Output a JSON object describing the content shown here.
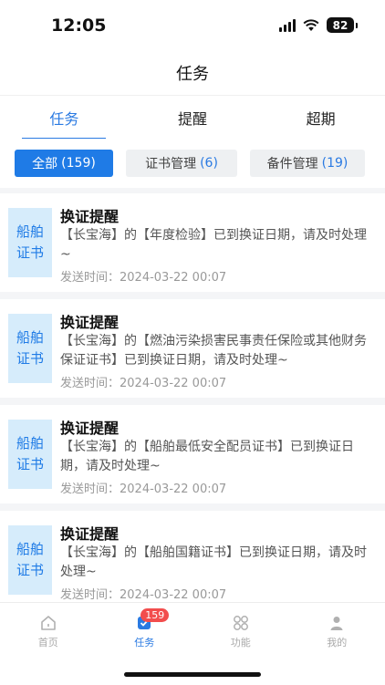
{
  "status_bar": {
    "time": "12:05",
    "battery": "82"
  },
  "nav": {
    "title": "任务"
  },
  "tabs": [
    {
      "label": "任务",
      "active": true
    },
    {
      "label": "提醒",
      "active": false
    },
    {
      "label": "超期",
      "active": false
    }
  ],
  "filters": [
    {
      "label": "全部",
      "count": "(159)",
      "active": true
    },
    {
      "label": "证书管理",
      "count": "(6)",
      "active": false
    },
    {
      "label": "备件管理",
      "count": "(19)",
      "active": false
    }
  ],
  "cards": [
    {
      "badge": "船舶证书",
      "title": "换证提醒",
      "body": "【长宝海】的【年度检验】已到换证日期，请及时处理~",
      "time": "发送时间：2024-03-22 00:07"
    },
    {
      "badge": "船舶证书",
      "title": "换证提醒",
      "body": "【长宝海】的【燃油污染损害民事责任保险或其他财务保证证书】已到换证日期，请及时处理~",
      "time": "发送时间：2024-03-22 00:07"
    },
    {
      "badge": "船舶证书",
      "title": "换证提醒",
      "body": "【长宝海】的【船舶最低安全配员证书】已到换证日期，请及时处理~",
      "time": "发送时间：2024-03-22 00:07"
    },
    {
      "badge": "船舶证书",
      "title": "换证提醒",
      "body": "【长宝海】的【船舶国籍证书】已到换证日期，请及时处理~",
      "time": "发送时间：2024-03-22 00:07"
    }
  ],
  "tabbar": {
    "items": [
      {
        "label": "首页",
        "icon": "home-icon"
      },
      {
        "label": "任务",
        "icon": "task-icon",
        "badge": "159"
      },
      {
        "label": "功能",
        "icon": "grid-icon"
      },
      {
        "label": "我的",
        "icon": "user-icon"
      }
    ]
  },
  "colors": {
    "accent": "#2a7ae2",
    "badge_bg": "#d6ecfb",
    "alert": "#f24d4d"
  }
}
